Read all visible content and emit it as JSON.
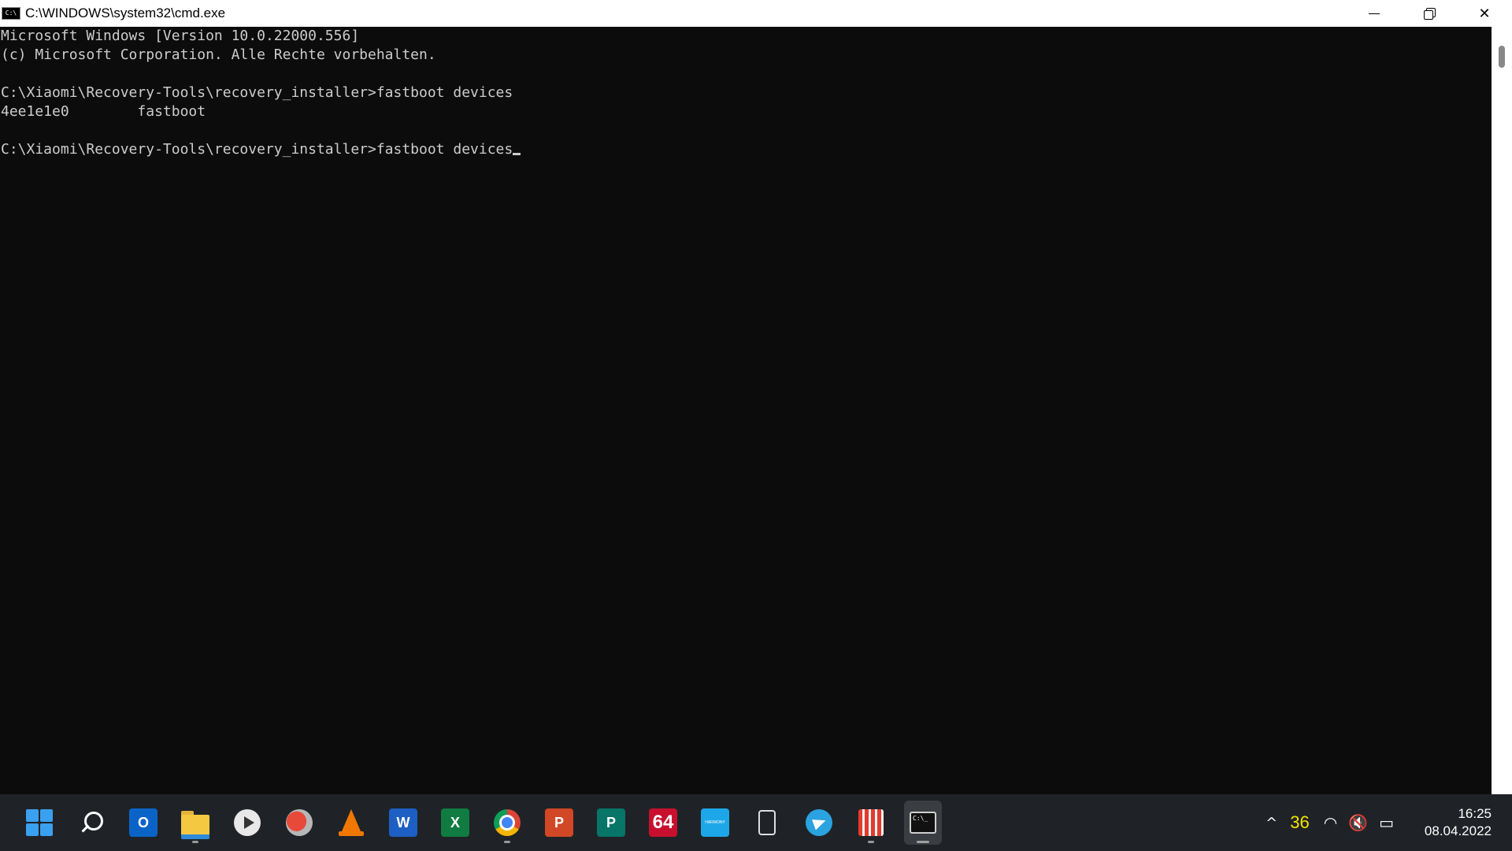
{
  "window": {
    "title": "C:\\WINDOWS\\system32\\cmd.exe",
    "icon_text": "C:\\"
  },
  "console": {
    "lines": [
      "Microsoft Windows [Version 10.0.22000.556]",
      "(c) Microsoft Corporation. Alle Rechte vorbehalten.",
      "",
      "C:\\Xiaomi\\Recovery-Tools\\recovery_installer>fastboot devices",
      "4ee1e1e0        fastboot",
      "",
      "C:\\Xiaomi\\Recovery-Tools\\recovery_installer>fastboot devices"
    ]
  },
  "taskbar": {
    "items": [
      {
        "name": "start-button",
        "icon": "windows-logo-icon"
      },
      {
        "name": "search-button",
        "icon": "search-icon"
      },
      {
        "name": "outlook-button",
        "icon": "outlook-icon",
        "label": "O"
      },
      {
        "name": "file-explorer-button",
        "icon": "folder-icon"
      },
      {
        "name": "media-player-button",
        "icon": "play-icon"
      },
      {
        "name": "ccleaner-button",
        "icon": "ccleaner-icon"
      },
      {
        "name": "vlc-button",
        "icon": "vlc-cone-icon"
      },
      {
        "name": "word-button",
        "icon": "word-icon",
        "label": "W"
      },
      {
        "name": "excel-button",
        "icon": "excel-icon",
        "label": "X"
      },
      {
        "name": "chrome-button",
        "icon": "chrome-icon"
      },
      {
        "name": "powerpoint-button",
        "icon": "powerpoint-icon",
        "label": "P"
      },
      {
        "name": "publisher-button",
        "icon": "publisher-icon",
        "label": "P"
      },
      {
        "name": "aida64-button",
        "icon": "aida64-icon",
        "label": "64"
      },
      {
        "name": "harmony-button",
        "icon": "harmony-icon",
        "label": "HARMONY"
      },
      {
        "name": "phone-link-button",
        "icon": "phone-icon"
      },
      {
        "name": "telegram-button",
        "icon": "telegram-icon"
      },
      {
        "name": "audio-app-button",
        "icon": "microphone-icon"
      },
      {
        "name": "terminal-button",
        "icon": "terminal-icon",
        "label": "C:\\_"
      }
    ],
    "accent_colors": {
      "windows": "#3aa0f0",
      "outlook": "#0a64c8",
      "word": "#1d5fc4",
      "excel": "#107c41",
      "powerpoint": "#d24726",
      "publisher": "#077568",
      "aida64": "#c8102e",
      "harmony": "#1ea7e8"
    }
  },
  "tray": {
    "chevron": "^",
    "temperature": "36",
    "wifi_icon": "wifi-icon",
    "volume_icon": "volume-muted-icon",
    "battery_icon": "battery-charging-icon",
    "time": "16:25",
    "date": "08.04.2022"
  }
}
